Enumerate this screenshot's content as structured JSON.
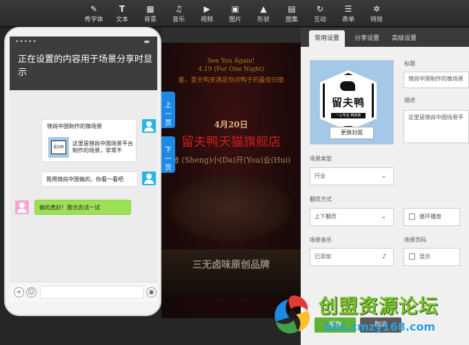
{
  "toolbar": {
    "items": [
      {
        "label": "秀字体",
        "icon": "brush-icon"
      },
      {
        "label": "文本",
        "icon": "text-icon"
      },
      {
        "label": "背景",
        "icon": "background-grid-icon"
      },
      {
        "label": "音乐",
        "icon": "music-icon"
      },
      {
        "label": "视频",
        "icon": "video-icon"
      },
      {
        "label": "图片",
        "icon": "image-icon"
      },
      {
        "label": "形状",
        "icon": "shape-icon"
      },
      {
        "label": "图集",
        "icon": "gallery-icon"
      },
      {
        "label": "互动",
        "icon": "interaction-icon"
      },
      {
        "label": "表单",
        "icon": "form-icon"
      },
      {
        "label": "特效",
        "icon": "effects-icon"
      }
    ]
  },
  "phone": {
    "title": "正在设置的内容用于场景分享时显示",
    "card_title": "锦尚中国制作的微场景",
    "card_desc": "这里是锦尚中国场景平台制作的场景，非常不",
    "reply1": "我用锦尚中国做的，你看一看吧",
    "reply2": "做的真好！我也去试一试"
  },
  "page_buttons": {
    "up": "上一页",
    "down": "下一页"
  },
  "scene": {
    "line1": "See You Again!",
    "line2": "4.19 (For One Night)",
    "line3": "宴，晋夫鸭来满足你对鸭子的最佳归宿",
    "date": "4月20日",
    "headline": "留夫鸭天猫旗舰店",
    "sheng": "微 (Sheng)小(Da)开(You)业(Hui)",
    "bottom_title": "三无卤味原创品牌"
  },
  "panel": {
    "tabs": [
      "常用设置",
      "分享设置",
      "高级设置"
    ],
    "active_tab": 0,
    "cover": {
      "logo_text": "留夫鸭",
      "logo_sub": "一心专业 鸭家族",
      "change_label": "更换封面"
    },
    "title_label": "标题",
    "title_value": "锦尚中国制作的微场景",
    "desc_label": "描述",
    "desc_value": "这里是锦尚中国场景平",
    "scene_type_label": "场景类型",
    "scene_type_value": "行业",
    "flip_label": "翻页方式",
    "flip_value": "上下翻页",
    "loop_label": "循环播放",
    "music_label": "场景音乐",
    "music_value": "已添加",
    "music_icon": "music-note-icon",
    "pagecode_label": "场景页码",
    "show_label": "显示"
  },
  "watermark": {
    "title": "创盟资源论坛",
    "url": "bbs.cmzy168.com"
  },
  "footer": {
    "save": "保存",
    "cancel": "取消"
  },
  "colors": {
    "accent_blue": "#1e88e5",
    "bubble_green": "#9be055",
    "avatar_blue": "#29b6e6",
    "avatar_pink": "#f4a7cf",
    "headline_red": "#c8201a"
  }
}
